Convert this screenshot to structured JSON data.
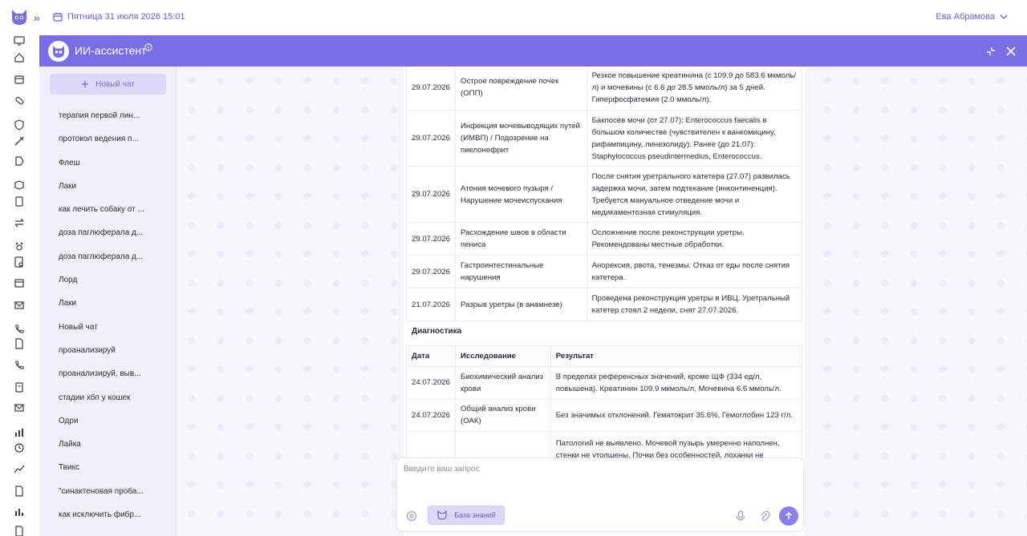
{
  "topbar": {
    "date_text": "Пятница 31 июля 2026 15:01",
    "user_name": "Ева Абрамова"
  },
  "assistant": {
    "title": "ИИ-ассистент",
    "new_chat_label": "Новый чат",
    "chats": [
      "терапия первой лин...",
      "протокол ведения п...",
      "Флеш",
      "Лаки",
      "как лечить собаку от ...",
      "доза паглюферала д...",
      "доза паглюферала д...",
      "Лорд",
      "Лаки",
      "Новый чат",
      "проанализируй",
      "проанализируй, выв...",
      "стадии хбп у кошек",
      "Одри",
      "Лайка",
      "Твикс",
      "\"синактеновая проба...",
      "как исключить фибр..."
    ]
  },
  "problems": [
    {
      "date": "29.07.2026",
      "name": "Острое повреждение почек (ОПП)",
      "desc": "Резкое повышение креатинина (с 109.9 до 583.6 мкмоль/л) и мочевины (с 6.6 до 28.5 ммоль/л) за 5 дней. Гиперфосфатемия (2.0 ммоль/л)."
    },
    {
      "date": "29.07.2026",
      "name": "Инфекция мочевыводящих путей (ИМВП) / Подозрение на пиелонефрит",
      "desc": "Бакпосев мочи (от 27.07): Enterococcus faecalis в большом количестве (чувствителен к ванкомицину, рифампицину, линезолиду). Ранее (до 21.07): Staphylococcus pseudintermedius, Enterococcus."
    },
    {
      "date": "29.07.2026",
      "name": "Атония мочевого пузыря / Нарушение мочеиспускания",
      "desc": "После снятия уретрального катетера (27.07) развилась задержка мочи, затем подтекание (инконтиненция). Требуется мануальное отведение мочи и медикаментозная стимуляция."
    },
    {
      "date": "29.07.2026",
      "name": "Расхождение швов в области пениса",
      "desc": "Осложнение после реконструкции уретры. Рекомендованы местные обработки."
    },
    {
      "date": "29.07.2026",
      "name": "Гастроинтестинальные нарушения",
      "desc": "Анорексия, рвота, тенезмы. Отказ от еды после снятия катетера."
    },
    {
      "date": "21.07.2026",
      "name": "Разрыв уретры (в анамнезе)",
      "desc": "Проведена реконструкция уретры в ИВЦ. Уретральный катетер стоял 2 недели, снят 27.07.2026."
    }
  ],
  "diagnostics": {
    "title": "Диагностика",
    "headers": {
      "date": "Дата",
      "study": "Исследование",
      "result": "Результат"
    },
    "rows": [
      {
        "date": "24.07.2026",
        "study": "Биохимический анализ крови",
        "result": "В пределах референсных значений, кроме ЩФ (334 ед/л, повышена). Креатинин 109.9 мкмоль/л, Мочевина 6.6 ммоль/л."
      },
      {
        "date": "24.07.2026",
        "study": "Общий анализ крови (ОАК)",
        "result": "Без значимых отклонений. Гематокрит 35.6%, Гемоглобин 123 г/л."
      },
      {
        "date": "",
        "study": "",
        "result": "Патологий не выявлено. Мочевой пузырь умеренно наполнен, стенки не утолщены. Почки без особенностей, лоханки не"
      }
    ]
  },
  "input": {
    "placeholder": "Введите ваш запрос",
    "kb_label": "База знаний"
  },
  "colors": {
    "accent": "#7a6ee6",
    "accent_light": "#dcd8f7",
    "send": "#8b7ff0"
  }
}
